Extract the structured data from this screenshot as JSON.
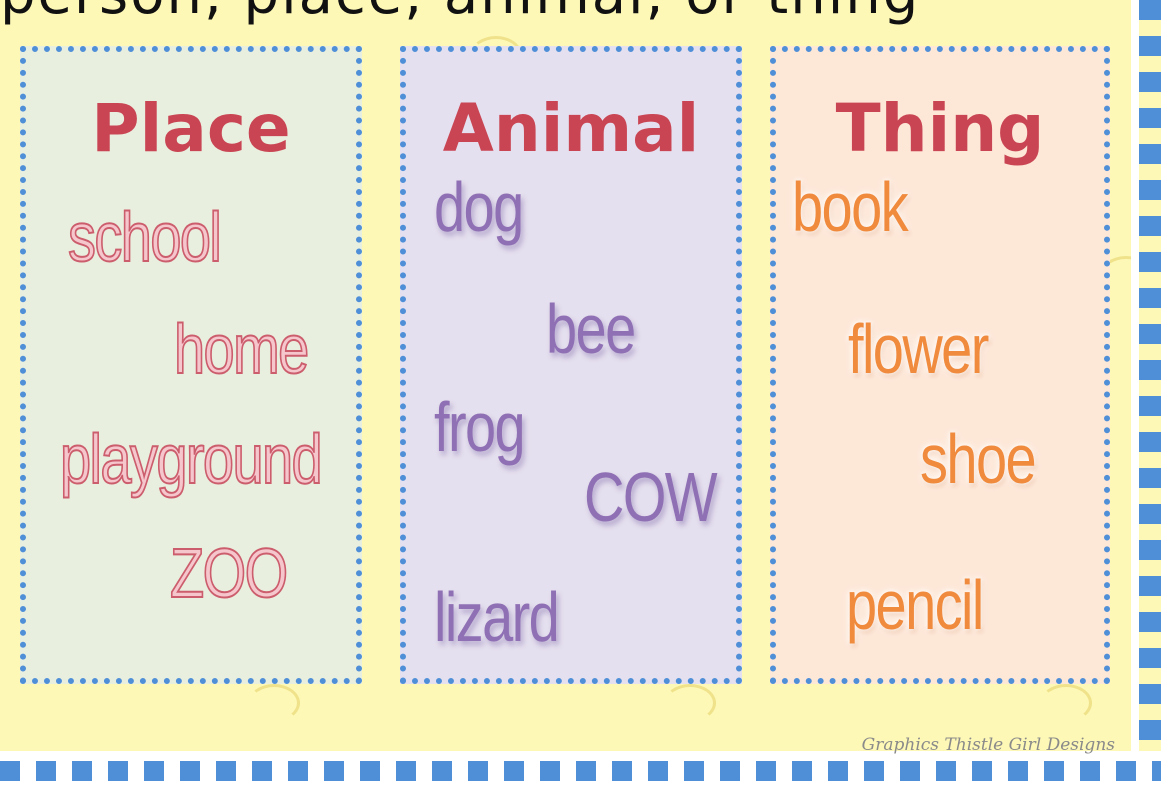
{
  "header": {
    "title": "person, place, animal, or thing"
  },
  "columns": [
    {
      "heading": "Place",
      "words": [
        "school",
        "home",
        "playground",
        "ZOO"
      ]
    },
    {
      "heading": "Animal",
      "words": [
        "dog",
        "bee",
        "frog",
        "COW",
        "lizard"
      ]
    },
    {
      "heading": "Thing",
      "words": [
        "book",
        "flower",
        "shoe",
        "pencil"
      ]
    }
  ],
  "footer": {
    "credit": "Graphics Thistle Girl Designs"
  },
  "colors": {
    "background": "#fdf8b6",
    "border": "#4f8fd8",
    "heading": "#c94553",
    "place_words": "#f6c6cd",
    "animal_words": "#8f70b4",
    "thing_words": "#f08a3c"
  }
}
